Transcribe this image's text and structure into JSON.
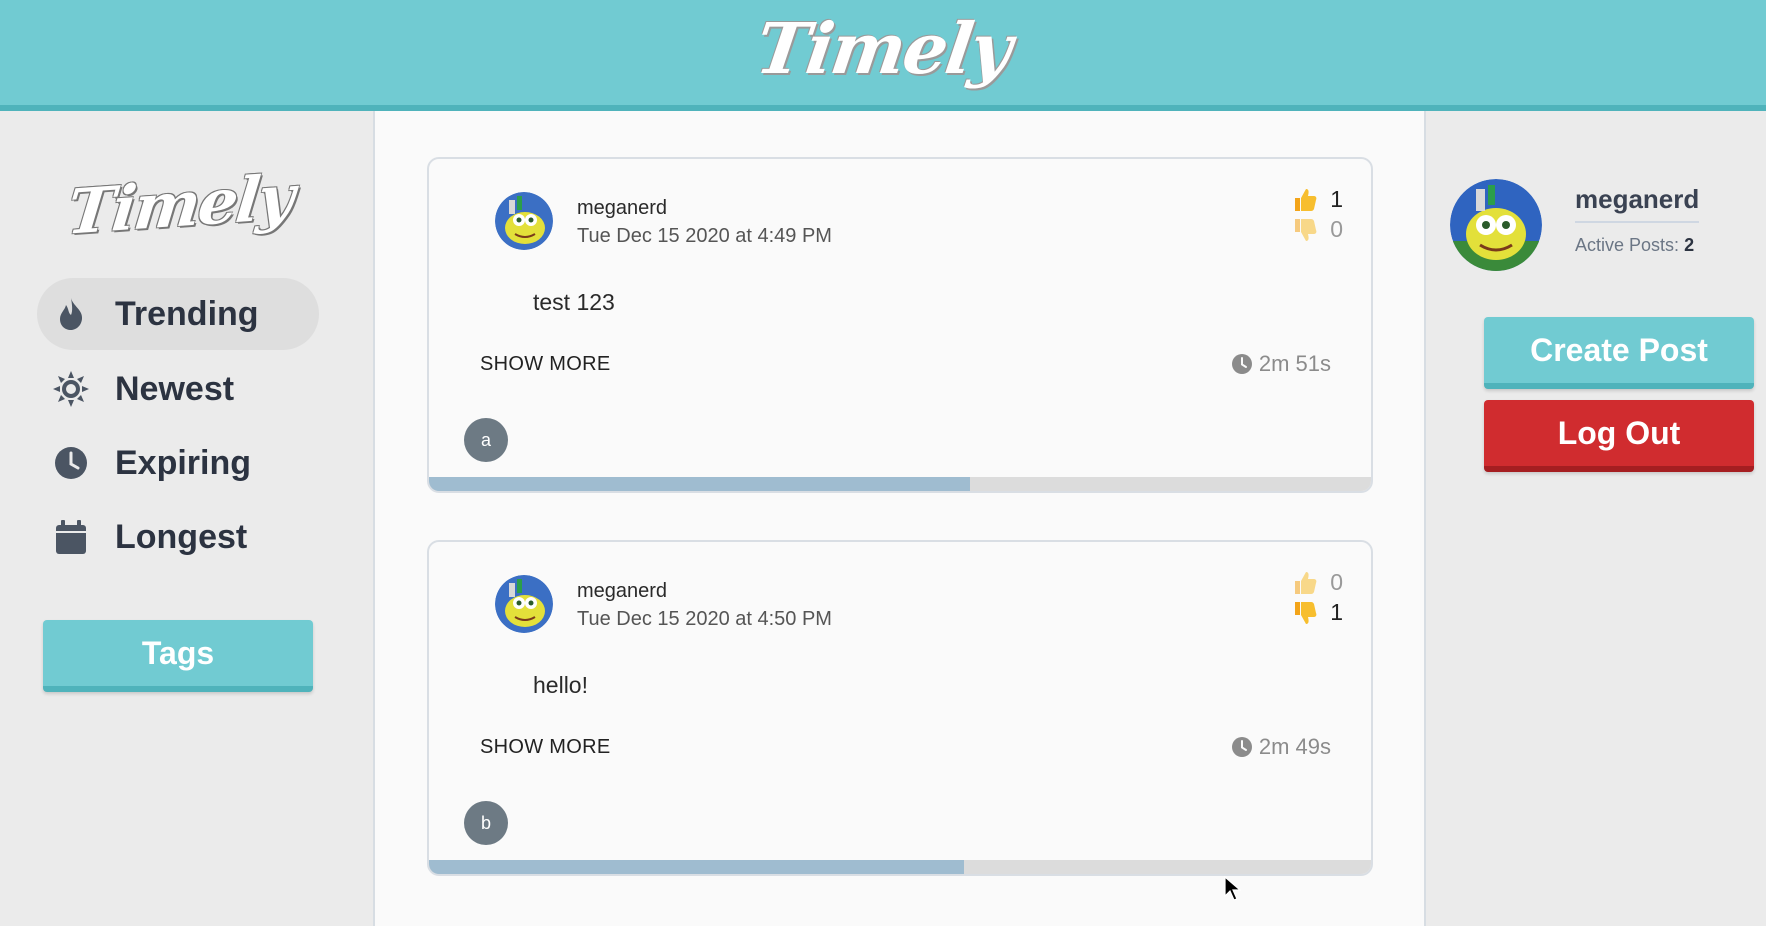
{
  "app": {
    "logo": "Timely"
  },
  "sidebar": {
    "logo": "Timely",
    "items": [
      {
        "label": "Trending",
        "icon": "fire-icon",
        "active": true
      },
      {
        "label": "Newest",
        "icon": "sun-icon",
        "active": false
      },
      {
        "label": "Expiring",
        "icon": "clock-icon",
        "active": false
      },
      {
        "label": "Longest",
        "icon": "calendar-icon",
        "active": false
      }
    ],
    "tags_label": "Tags"
  },
  "posts": [
    {
      "username": "meganerd",
      "timestamp": "Tue Dec 15 2020 at 4:49 PM",
      "likes": "1",
      "dislikes": "0",
      "content": "test 123",
      "show_more": "SHOW MORE",
      "timer": "2m 51s",
      "tag": "a",
      "progress": 0.574
    },
    {
      "username": "meganerd",
      "timestamp": "Tue Dec 15 2020 at 4:50 PM",
      "likes": "0",
      "dislikes": "1",
      "content": "hello!",
      "show_more": "SHOW MORE",
      "timer": "2m 49s",
      "tag": "b",
      "progress": 0.568
    }
  ],
  "profile": {
    "username": "meganerd",
    "active_posts_label": "Active Posts:",
    "active_posts_count": "2",
    "create_post_label": "Create Post",
    "logout_label": "Log Out"
  },
  "colors": {
    "accent": "#71cbd2",
    "accent_dark": "#4fb3bb",
    "danger": "#d02c2f",
    "progress": "#9fbcd0"
  }
}
